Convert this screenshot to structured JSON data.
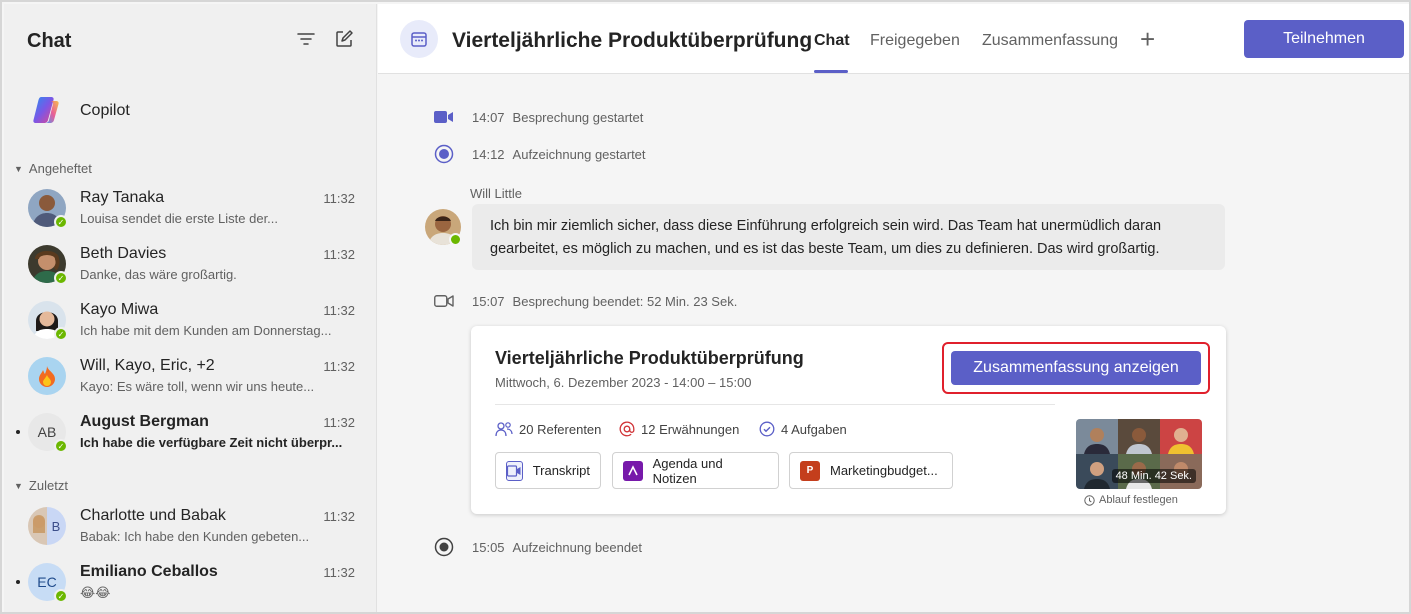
{
  "sidebar": {
    "title": "Chat",
    "icons": [
      "filter-icon",
      "compose-icon"
    ],
    "copilot_label": "Copilot",
    "pinned_label": "Angeheftet",
    "recent_label": "Zuletzt",
    "pinned": [
      {
        "name": "Ray Tanaka",
        "time": "11:32",
        "preview": "Louisa sendet die erste Liste der...",
        "bold": false
      },
      {
        "name": "Beth Davies",
        "time": "11:32",
        "preview": "Danke, das wäre großartig.",
        "bold": false
      },
      {
        "name": "Kayo Miwa",
        "time": "11:32",
        "preview": "Ich habe mit dem Kunden am Donnerstag...",
        "bold": false
      },
      {
        "name": "Will, Kayo, Eric, +2",
        "time": "11:32",
        "preview": "Kayo: Es wäre toll, wenn wir uns heute...",
        "bold": false
      },
      {
        "name": "August Bergman",
        "time": "11:32",
        "preview": "Ich habe die verfügbare Zeit nicht überpr...",
        "bold": true,
        "initials": "AB"
      }
    ],
    "recent": [
      {
        "name": "Charlotte und Babak",
        "time": "11:32",
        "preview": "Babak: Ich habe den Kunden gebeten...",
        "bold": false
      },
      {
        "name": "Emiliano Ceballos",
        "time": "11:32",
        "preview": "😂😂",
        "bold": true,
        "initials": "EC"
      }
    ]
  },
  "header": {
    "meeting_title": "Vierteljährliche Produktüberprüfung",
    "tabs": [
      {
        "label": "Chat",
        "active": true
      },
      {
        "label": "Freigegeben",
        "active": false
      },
      {
        "label": "Zusammenfassung",
        "active": false
      }
    ],
    "add_tab": "+",
    "join_label": "Teilnehmen"
  },
  "events": {
    "meeting_started": {
      "time": "14:07",
      "text": "Besprechung gestartet"
    },
    "recording_started": {
      "time": "14:12",
      "text": "Aufzeichnung gestartet"
    },
    "meeting_ended": {
      "time": "15:07",
      "text": "Besprechung beendet: 52 Min. 23 Sek."
    },
    "recording_ended": {
      "time": "15:05",
      "text": "Aufzeichnung beendet"
    }
  },
  "message": {
    "author": "Will Little",
    "text": "Ich bin mir ziemlich sicher, dass diese Einführung erfolgreich sein wird. Das Team hat unermüdlich daran gearbeitet, es möglich zu machen, und es ist das beste Team, um dies zu definieren. Das wird großartig."
  },
  "card": {
    "title": "Vierteljährliche Produktüberprüfung",
    "subtitle": "Mittwoch, 6. Dezember 2023  - 14:00 – 15:00",
    "summary_button": "Zusammenfassung anzeigen",
    "stats": {
      "speakers": "20 Referenten",
      "mentions": "12 Erwähnungen",
      "tasks": "4 Aufgaben"
    },
    "files": {
      "transcript": "Transkript",
      "agenda": "Agenda und Notizen",
      "budget": "Marketingbudget..."
    },
    "recording_duration": "48 Min. 42 Sek.",
    "expire_label": "Ablauf festlegen"
  },
  "colors": {
    "accent": "#5b5fc7",
    "highlight": "#e0202c",
    "presence": "#6bb700"
  }
}
